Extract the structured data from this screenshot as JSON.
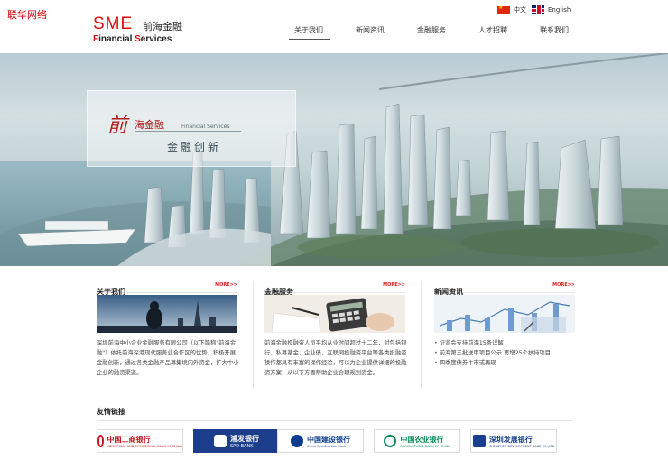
{
  "watermark": "联华网络",
  "header": {
    "logo_sme": "SME",
    "logo_cn": "前海金融",
    "logo_en_parts": [
      "F",
      "inancial ",
      "S",
      "ervices"
    ],
    "lang": [
      {
        "label": "中文",
        "flag": "cn-flag-icon"
      },
      {
        "label": "English",
        "flag": "uk-flag-icon"
      }
    ],
    "nav": [
      "关于我们",
      "新闻资讯",
      "金融服务",
      "人才招聘",
      "联系我们"
    ],
    "active_nav": "关于我们"
  },
  "banner": {
    "qian": "前",
    "brand": "海金融",
    "en": "Financial Services",
    "slogan": "金融创新"
  },
  "sections": {
    "about": {
      "title": "关于我们",
      "more": "MORE>>",
      "text": "深圳前海中小企业金融服务有限公司（以下简称\"前海金融\"）依托前海深港现代服务业合作区的优势，积极开展金融创新，通过各类金融产品募集境内外资金，扩大中小企业的融资渠道。"
    },
    "services": {
      "title": "金融服务",
      "more": "MORE>>",
      "text": "前海金融投融资人员平均从业时间超过十二年，对包括银行、私募基金、企业债、互联网投融资平台等各类投融资操作都具有丰富的操作经验，可以为企业提供详细的投融资方案，从以下方面帮助企业合理规划资金。"
    },
    "news": {
      "title": "新闻资讯",
      "more": "MORE>>",
      "items": [
        "证监会支持前海15条详解",
        "前海第三批送审项目公示 再增25个扶持项目",
        "四季度债券牛市或再现"
      ]
    }
  },
  "friend_links": {
    "title": "友情链接",
    "banks": [
      {
        "name": "中国工商银行",
        "sub": "INDUSTRIAL AND COMMERCIAL BANK OF CHINA",
        "color": "#c8161d",
        "icon": "icbc-logo-icon"
      },
      {
        "name": "浦发银行",
        "sub": "SPD BANK",
        "color": "#ffffff",
        "icon": "spd-logo-icon"
      },
      {
        "name": "中国建设银行",
        "sub": "China Construction Bank",
        "color": "#0a3d8f",
        "icon": "ccb-logo-icon"
      },
      {
        "name": "中国农业银行",
        "sub": "AGRICULTURAL BANK OF CHINA",
        "color": "#0a8a56",
        "icon": "abc-logo-icon"
      },
      {
        "name": "深圳发展银行",
        "sub": "SHENZHEN DEVELOPMENT BANK CO.,LTD",
        "color": "#1a3f8f",
        "icon": "sdb-logo-icon"
      }
    ]
  }
}
